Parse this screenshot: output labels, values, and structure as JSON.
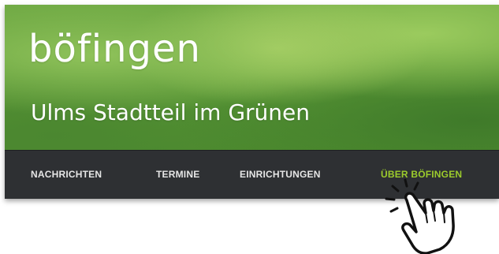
{
  "header": {
    "site_title": "böfingen",
    "subtitle": "Ulms Stadtteil im Grünen"
  },
  "nav": {
    "items": [
      {
        "label": "NACHRICHTEN",
        "active": false
      },
      {
        "label": "TERMINE",
        "active": false
      },
      {
        "label": "EINRICHTUNGEN",
        "active": false
      },
      {
        "label": "ÜBER BÖFINGEN",
        "active": true
      }
    ]
  },
  "cursor": {
    "icon": "hand-pointer-click-icon"
  },
  "colors": {
    "nav_background": "#2e3033",
    "nav_text": "#e6e6e6",
    "nav_active": "#9ccc2c",
    "banner_green": "#6ea843"
  }
}
